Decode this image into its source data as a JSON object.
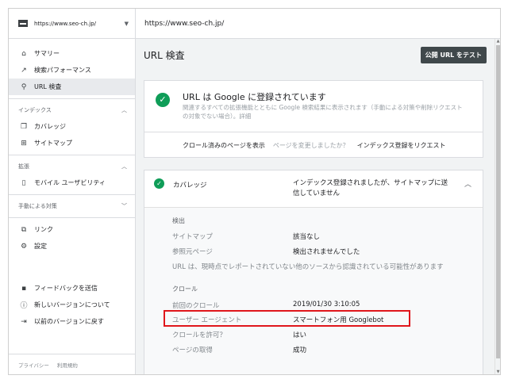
{
  "sidebar": {
    "property": "https://www.seo-ch.jp/",
    "nav": [
      {
        "label": "サマリー",
        "icon": "home-icon"
      },
      {
        "label": "検索パフォーマンス",
        "icon": "trending-icon"
      },
      {
        "label": "URL 検査",
        "icon": "search-icon"
      }
    ],
    "index_section": "インデックス",
    "index_items": [
      {
        "label": "カバレッジ",
        "icon": "coverage-icon"
      },
      {
        "label": "サイトマップ",
        "icon": "sitemap-icon"
      }
    ],
    "enhance_section": "拡張",
    "enhance_items": [
      {
        "label": "モバイル ユーザビリティ",
        "icon": "mobile-icon"
      }
    ],
    "manual_section": "手動による対策",
    "misc_items": [
      {
        "label": "リンク",
        "icon": "links-icon"
      },
      {
        "label": "設定",
        "icon": "settings-icon"
      }
    ],
    "bottom_items": [
      {
        "label": "フィードバックを送信",
        "icon": "feedback-icon"
      },
      {
        "label": "新しいバージョンについて",
        "icon": "info-icon"
      },
      {
        "label": "以前のバージョンに戻す",
        "icon": "exit-icon"
      }
    ],
    "footer": {
      "privacy": "プライバシー",
      "terms": "利用規約"
    }
  },
  "topbar": {
    "url": "https://www.seo-ch.jp/"
  },
  "main": {
    "title": "URL 検査",
    "test_button": "公開 URL をテスト",
    "status": {
      "title": "URL は Google に登録されています",
      "desc": "関連するすべての拡張機能とともに Google 検索結果に表示されます（手動による対策や削除リクエストの対象でない場合）。詳細",
      "action_view": "クロール済みのページを表示",
      "action_changed": "ページを変更しましたか？",
      "action_request": "インデックス登録をリクエスト"
    },
    "coverage": {
      "label": "カバレッジ",
      "status": "インデックス登録されましたが、サイトマップに送信していません",
      "discovery_label": "検出",
      "sitemap_key": "サイトマップ",
      "sitemap_val": "該当なし",
      "referrer_key": "参照元ページ",
      "referrer_val": "検出されませんでした",
      "note": "URL は、現時点でレポートされていない他のソースから認識されている可能性があります",
      "crawl_label": "クロール",
      "last_crawl_key": "前回のクロール",
      "last_crawl_val": "2019/01/30 3:10:05",
      "ua_key": "ユーザー エージェント",
      "ua_val": "スマートフォン用 Googlebot",
      "allowed_key": "クロールを許可？",
      "allowed_val": "はい",
      "fetch_key": "ページの取得",
      "fetch_val": "成功"
    }
  },
  "colors": {
    "success": "#0f9d58",
    "highlight": "#e0161b",
    "button": "#40484b"
  }
}
